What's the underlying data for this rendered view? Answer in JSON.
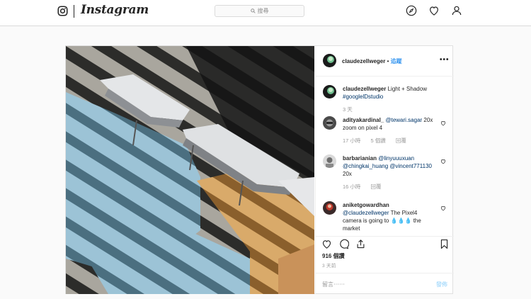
{
  "brand": {
    "name": "Instagram"
  },
  "search": {
    "placeholder": "搜尋",
    "icon": "search-icon"
  },
  "nav": {
    "icons": [
      "explore-icon",
      "heart-icon",
      "profile-icon"
    ]
  },
  "post": {
    "author": {
      "username": "claudezellweger",
      "follow_label": "追蹤",
      "separator": "•"
    },
    "more_label": "•••",
    "caption": {
      "username": "claudezellweger",
      "text": "Light + Shadow",
      "hashtag": "#googlelDstudio",
      "time": "3 天"
    },
    "comments": [
      {
        "username": "adityakardinal_",
        "mention": "@tewari.sagar",
        "text": "20x zoom on pixel 4",
        "time": "17 小時",
        "likes": "5 個讚",
        "reply": "回覆"
      },
      {
        "username": "barbarianian",
        "mentions": "@linyuuuxuan @chingkai_huang @vincent771130",
        "text": "20x",
        "time": "16 小時",
        "reply": "回覆"
      },
      {
        "username": "aniketgowardhan",
        "mention": "@claudezellweger",
        "text": "The Pixel4 camera is going to 💧💧💧 the market"
      }
    ],
    "likes_count": "916 個讚",
    "time_ago": "3 天前",
    "add_comment_placeholder": "留言⋯⋯",
    "post_button": "發佈"
  },
  "colors": {
    "link": "#003569",
    "follow": "#3897f0",
    "border": "#dbdbdb",
    "meta": "#999999",
    "post_disabled": "#b2dffc"
  }
}
